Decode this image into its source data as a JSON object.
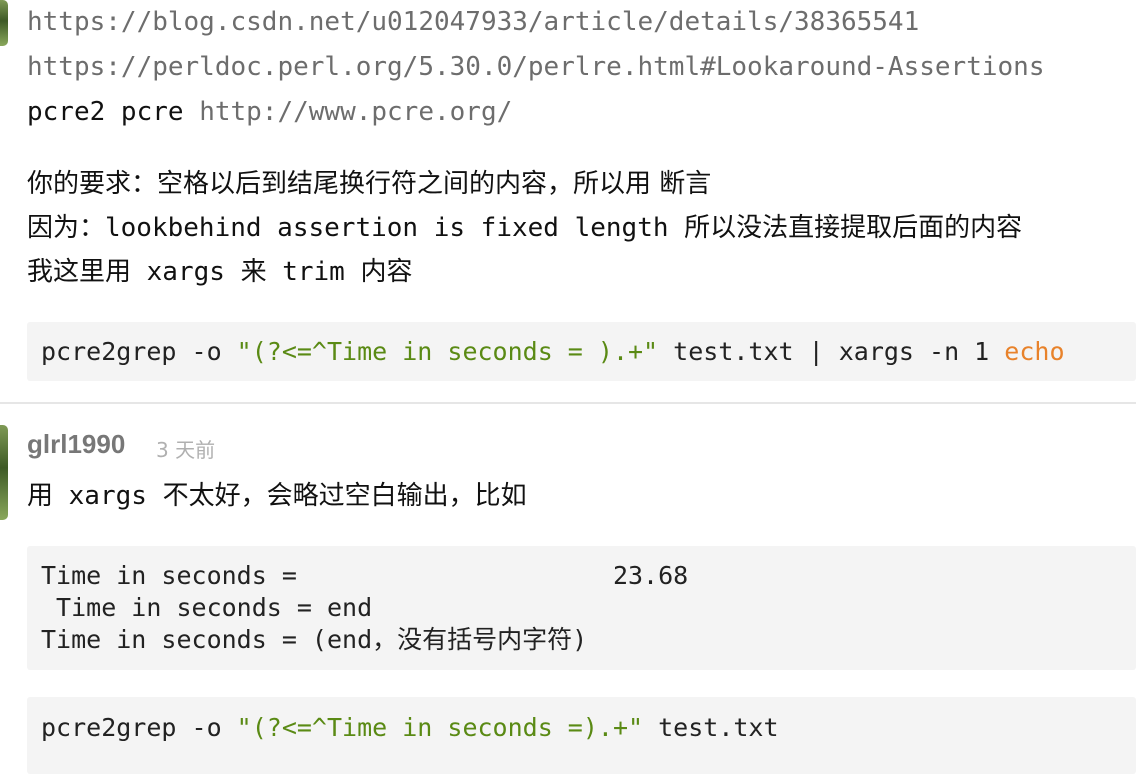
{
  "post": {
    "links": [
      "https://blog.csdn.net/u012047933/article/details/38365541",
      "https://perldoc.perl.org/5.30.0/perlre.html#Lookaround-Assertions"
    ],
    "pcre_line_prefix": "pcre2 pcre ",
    "pcre_link": "http://www.pcre.org/",
    "explanation_lines": [
      "你的要求：空格以后到结尾换行符之间的内容，所以用 断言",
      "因为：lookbehind assertion is fixed length 所以没法直接提取后面的内容",
      "我这里用 xargs 来 trim 内容"
    ],
    "code": {
      "cmd": "pcre2grep -o ",
      "pattern": "\"(?<=^Time in seconds = ).+\"",
      "rest": " test.txt | xargs -n 1 ",
      "keyword": "echo"
    }
  },
  "comment": {
    "author": "glrl1990",
    "time": "3 天前",
    "text": "用 xargs 不太好，会略过空白输出，比如",
    "sample_lines": [
      "Time in seconds =                     23.68",
      " Time in seconds = end",
      "Time in seconds = (end，没有括号内字符)"
    ],
    "code": {
      "cmd": "pcre2grep -o ",
      "pattern": "\"(?<=^Time in seconds =).+\"",
      "rest": " test.txt"
    }
  }
}
